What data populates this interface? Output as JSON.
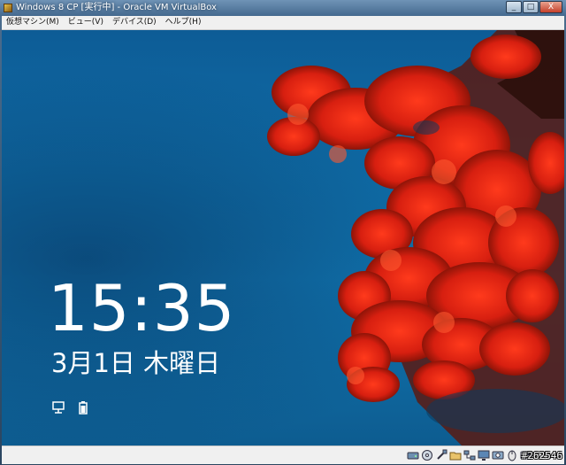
{
  "window": {
    "title": "Windows 8 CP [実行中] - Oracle VM VirtualBox",
    "buttons": {
      "minimize": "_",
      "maximize": "□",
      "close": "X"
    }
  },
  "menubar": {
    "items": [
      "仮想マシン(M)",
      "ビュー(V)",
      "デバイス(D)",
      "ヘルプ(H)"
    ]
  },
  "lockscreen": {
    "time": "15:35",
    "date": "3月1日 木曜日",
    "status_icons": [
      "network-icon",
      "battery-icon"
    ]
  },
  "statusbar": {
    "icons": [
      "hard-disk-icon",
      "optical-drive-icon",
      "usb-icon",
      "shared-folders-icon",
      "network-adapter-icon",
      "display-icon",
      "capture-icon",
      "mouse-integration-icon",
      "host-key-icon"
    ]
  },
  "watermark": "#262546"
}
